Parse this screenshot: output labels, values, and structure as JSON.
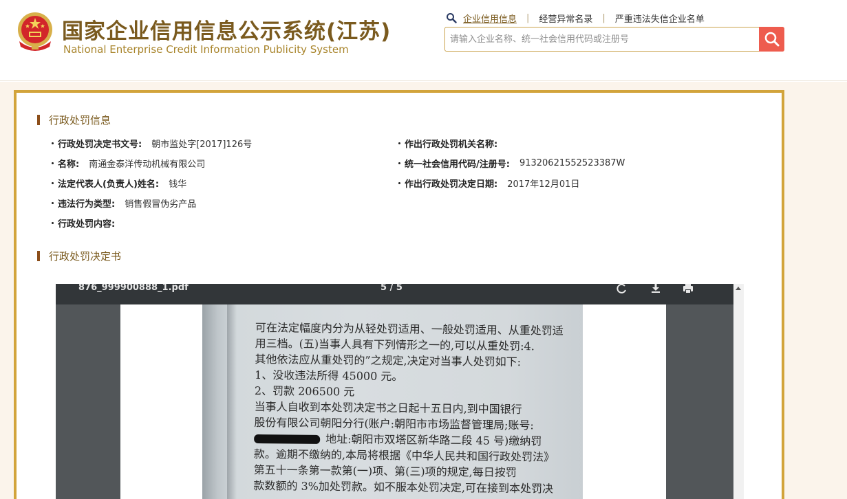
{
  "header": {
    "title_cn": "国家企业信用信息公示系统(江苏)",
    "title_en": "National Enterprise Credit Information Publicity System",
    "nav": [
      {
        "label": "企业信用信息",
        "active": true
      },
      {
        "label": "经营异常名录",
        "active": false
      },
      {
        "label": "严重违法失信企业名单",
        "active": false
      }
    ],
    "search_placeholder": "请输入企业名称、统一社会信用代码或注册号"
  },
  "penalty_info": {
    "section_title": "行政处罚信息",
    "fields": {
      "decision_no": {
        "label": "行政处罚决定书文号:",
        "value": "朝市监处字[2017]126号"
      },
      "authority": {
        "label": "作出行政处罚机关名称:",
        "value": ""
      },
      "name": {
        "label": "名称:",
        "value": "南通金泰洋传动机械有限公司"
      },
      "credit_code": {
        "label": "统一社会信用代码/注册号:",
        "value": "91320621552523387W"
      },
      "legal_rep": {
        "label": "法定代表人(负责人)姓名:",
        "value": "钱华"
      },
      "decision_date": {
        "label": "作出行政处罚决定日期:",
        "value": "2017年12月01日"
      },
      "violation_type": {
        "label": "违法行为类型:",
        "value": "销售假冒伪劣产品"
      },
      "content": {
        "label": "行政处罚内容:",
        "value": ""
      }
    }
  },
  "decision_doc": {
    "section_title": "行政处罚决定书",
    "viewer": {
      "filename": "876_999900888_1.pdf",
      "page_indicator": "5 / 5"
    },
    "scan_text": [
      "可在法定幅度内分为从轻处罚适用、一般处罚适用、从重处罚适",
      "用三档。(五)当事人具有下列情形之一的,可以从重处罚:4.",
      "其他依法应从重处罚的”之规定,决定对当事人处罚如下:",
      "    1、没收违法所得 45000 元。",
      "    2、罚款 206500 元",
      "    当事人自收到本处罚决定书之日起十五日内,到中国银行",
      "股份有限公司朝阳分行(账户:朝阳市市场监督管理局;账号:",
      "地址:朝阳市双塔区新华路二段 45 号)缴纳罚",
      "款。逾期不缴纳的,本局将根据《中华人民共和国行政处罚法》",
      "第五十一条第一款第(一)项、第(三)项的规定,每日按罚",
      "款数额的 3%加处罚款。如不服本处罚决定,可在接到本处罚决"
    ]
  },
  "colors": {
    "brand_brown": "#7a5a1e",
    "panel_border": "#d2a43b",
    "search_button": "#ee5c4e",
    "page_background": "#fbf4eb"
  }
}
